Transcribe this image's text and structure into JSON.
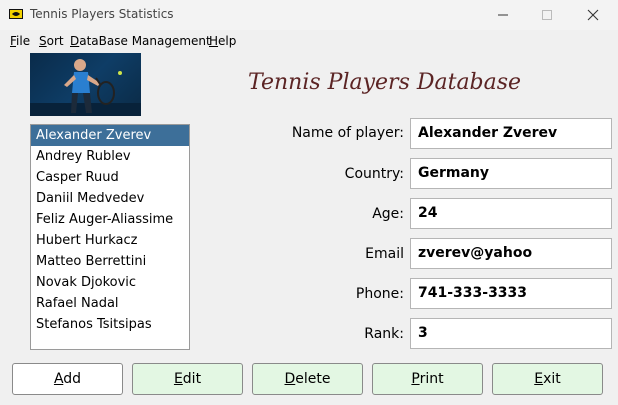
{
  "window": {
    "title": "Tennis Players Statistics"
  },
  "menu": {
    "file": {
      "hotkey": "F",
      "rest": "ile"
    },
    "sort": {
      "hotkey": "S",
      "rest": "ort"
    },
    "database": {
      "hotkey": "D",
      "rest": "ataBase Management"
    },
    "help": {
      "hotkey": "H",
      "rest": "elp"
    }
  },
  "heading": "Tennis Players Database",
  "players": [
    "Alexander Zverev",
    "Andrey Rublev",
    "Casper Ruud",
    "Daniil Medvedev",
    "Feliz Auger-Aliassime",
    "Hubert Hurkacz",
    "Matteo Berrettini",
    "Novak Djokovic",
    "Rafael Nadal",
    "Stefanos Tsitsipas"
  ],
  "selected_player": "Alexander Zverev",
  "form": {
    "name_label": "Name of player:",
    "name_value": "Alexander Zverev",
    "country_label": "Country:",
    "country_value": "Germany",
    "age_label": "Age:",
    "age_value": "24",
    "email_label": "Email",
    "email_value": "zverev@yahoo",
    "phone_label": "Phone:",
    "phone_value": "741-333-3333",
    "rank_label": "Rank:",
    "rank_value": "3"
  },
  "buttons": {
    "add": {
      "hotkey": "A",
      "rest": "dd"
    },
    "edit": {
      "hotkey": "E",
      "rest": "dit"
    },
    "delete": {
      "hotkey": "D",
      "rest": "elete"
    },
    "print": {
      "hotkey": "P",
      "rest": "rint"
    },
    "exit": {
      "hotkey": "E",
      "rest": "xit"
    }
  },
  "colors": {
    "selection": "#3d6f99",
    "heading": "#5b2424",
    "button_green": "#e3f7e3"
  }
}
